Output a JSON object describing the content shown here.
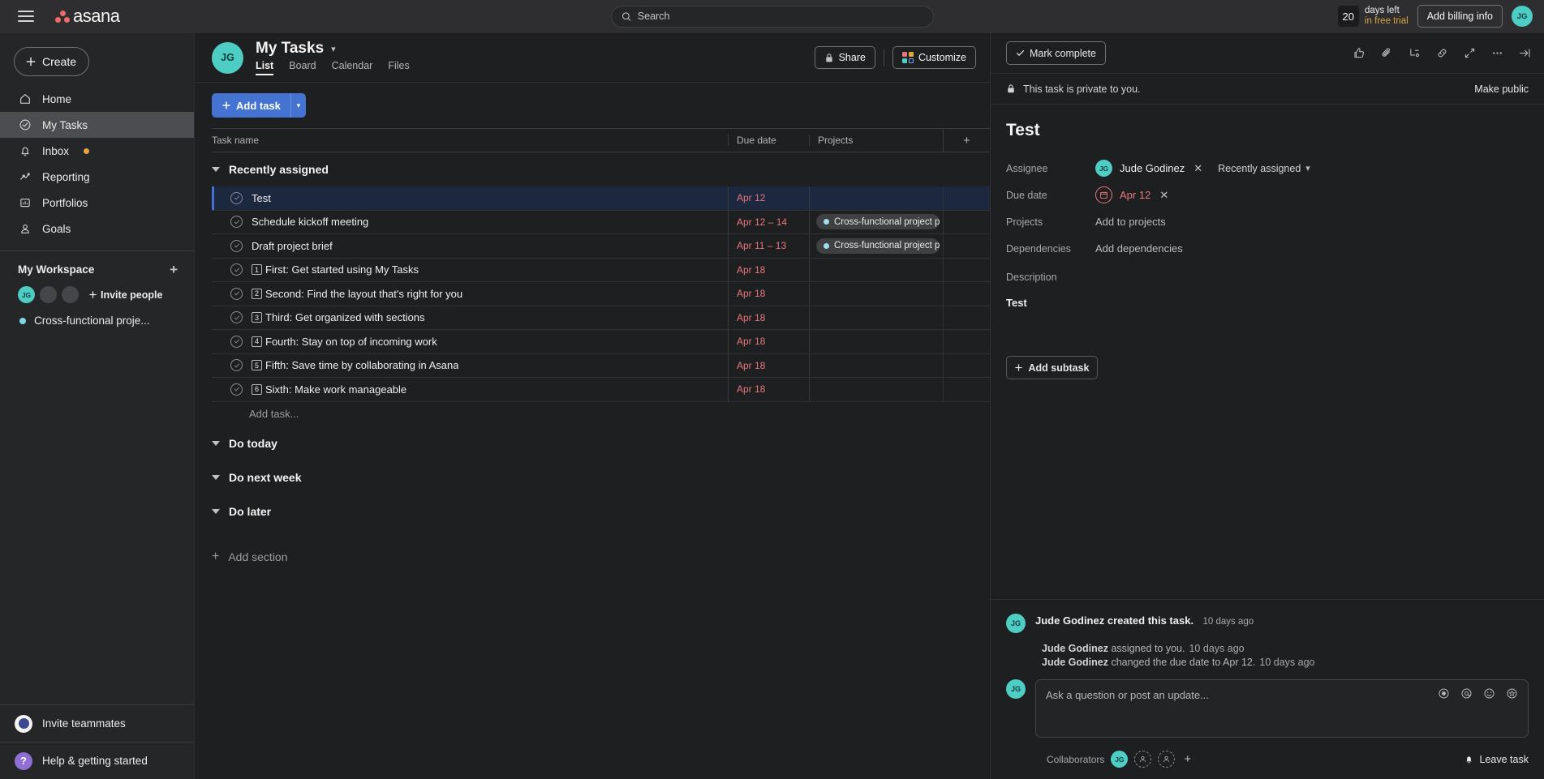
{
  "topbar": {
    "menu_icon": "hamburger-icon",
    "brand": "asana",
    "search_placeholder": "Search",
    "trial": {
      "days": "20",
      "line1": "days left",
      "line2": "in free trial"
    },
    "billing_button": "Add billing info",
    "user_initials": "JG"
  },
  "sidebar": {
    "create_label": "Create",
    "items": [
      {
        "label": "Home",
        "icon": "home-icon",
        "active": false,
        "badge": false
      },
      {
        "label": "My Tasks",
        "icon": "check-circle-icon",
        "active": true,
        "badge": false
      },
      {
        "label": "Inbox",
        "icon": "bell-icon",
        "active": false,
        "badge": true
      },
      {
        "label": "Reporting",
        "icon": "chart-line-icon",
        "active": false,
        "badge": false
      },
      {
        "label": "Portfolios",
        "icon": "portfolio-icon",
        "active": false,
        "badge": false
      },
      {
        "label": "Goals",
        "icon": "goal-icon",
        "active": false,
        "badge": false
      }
    ],
    "workspace_title": "My Workspace",
    "invite_people": "Invite people",
    "project": "Cross-functional proje...",
    "member_initials": "JG",
    "bottom": [
      {
        "label": "Invite teammates",
        "icon": "invite-teammates-icon"
      },
      {
        "label": "Help & getting started",
        "icon": "help-icon"
      }
    ]
  },
  "main_header": {
    "avatar_initials": "JG",
    "title": "My Tasks",
    "tabs": [
      {
        "label": "List",
        "active": true
      },
      {
        "label": "Board",
        "active": false
      },
      {
        "label": "Calendar",
        "active": false
      },
      {
        "label": "Files",
        "active": false
      }
    ],
    "share_label": "Share",
    "customize_label": "Customize"
  },
  "list": {
    "add_task_label": "Add task",
    "columns": {
      "name": "Task name",
      "due": "Due date",
      "projects": "Projects"
    },
    "add_task_row_label": "Add task...",
    "add_section_label": "Add section",
    "sections": [
      {
        "title": "Recently assigned",
        "tasks": [
          {
            "num": "",
            "name": "Test",
            "due": "Apr 12",
            "project": "",
            "selected": true
          },
          {
            "num": "",
            "name": "Schedule kickoff meeting",
            "due": "Apr 12 – 14",
            "project": "Cross-functional project pl...",
            "selected": false
          },
          {
            "num": "",
            "name": "Draft project brief",
            "due": "Apr 11 – 13",
            "project": "Cross-functional project pl...",
            "selected": false
          },
          {
            "num": "1",
            "name": "First: Get started using My Tasks",
            "due": "Apr 18",
            "project": "",
            "selected": false
          },
          {
            "num": "2",
            "name": "Second: Find the layout that's right for you",
            "due": "Apr 18",
            "project": "",
            "selected": false
          },
          {
            "num": "3",
            "name": "Third: Get organized with sections",
            "due": "Apr 18",
            "project": "",
            "selected": false
          },
          {
            "num": "4",
            "name": "Fourth: Stay on top of incoming work",
            "due": "Apr 18",
            "project": "",
            "selected": false
          },
          {
            "num": "5",
            "name": "Fifth: Save time by collaborating in Asana",
            "due": "Apr 18",
            "project": "",
            "selected": false
          },
          {
            "num": "6",
            "name": "Sixth: Make work manageable",
            "due": "Apr 18",
            "project": "",
            "selected": false
          }
        ]
      },
      {
        "title": "Do today",
        "tasks": []
      },
      {
        "title": "Do next week",
        "tasks": []
      },
      {
        "title": "Do later",
        "tasks": []
      }
    ]
  },
  "detail": {
    "mark_complete": "Mark complete",
    "privacy_text": "This task is private to you.",
    "make_public": "Make public",
    "task_title": "Test",
    "fields": {
      "assignee_label": "Assignee",
      "assignee_name": "Jude Godinez",
      "assignee_initials": "JG",
      "assignee_section": "Recently assigned",
      "due_label": "Due date",
      "due_value": "Apr 12",
      "projects_label": "Projects",
      "projects_value": "Add to projects",
      "dependencies_label": "Dependencies",
      "dependencies_value": "Add dependencies",
      "description_label": "Description",
      "description_value": "Test"
    },
    "add_subtask": "Add subtask",
    "activity": {
      "avatar_initials": "JG",
      "headline": "Jude Godinez created this task.",
      "headline_time": "10 days ago",
      "entries": [
        {
          "actor": "Jude Godinez",
          "text": "assigned to you.",
          "time": "10 days ago"
        },
        {
          "actor": "Jude Godinez",
          "text": "changed the due date to Apr 12.",
          "time": "10 days ago"
        }
      ]
    },
    "composer": {
      "avatar_initials": "JG",
      "placeholder": "Ask a question or post an update...",
      "collaborators_label": "Collaborators",
      "collaborator_initials": "JG",
      "leave_task": "Leave task"
    }
  },
  "colors": {
    "accent_blue": "#4573d2",
    "brand_red": "#f06a6a",
    "teal_avatar": "#4ecdc4",
    "due_red": "#e8777d",
    "trial_gold": "#d9a441",
    "project_dot": "#9fdff0"
  }
}
